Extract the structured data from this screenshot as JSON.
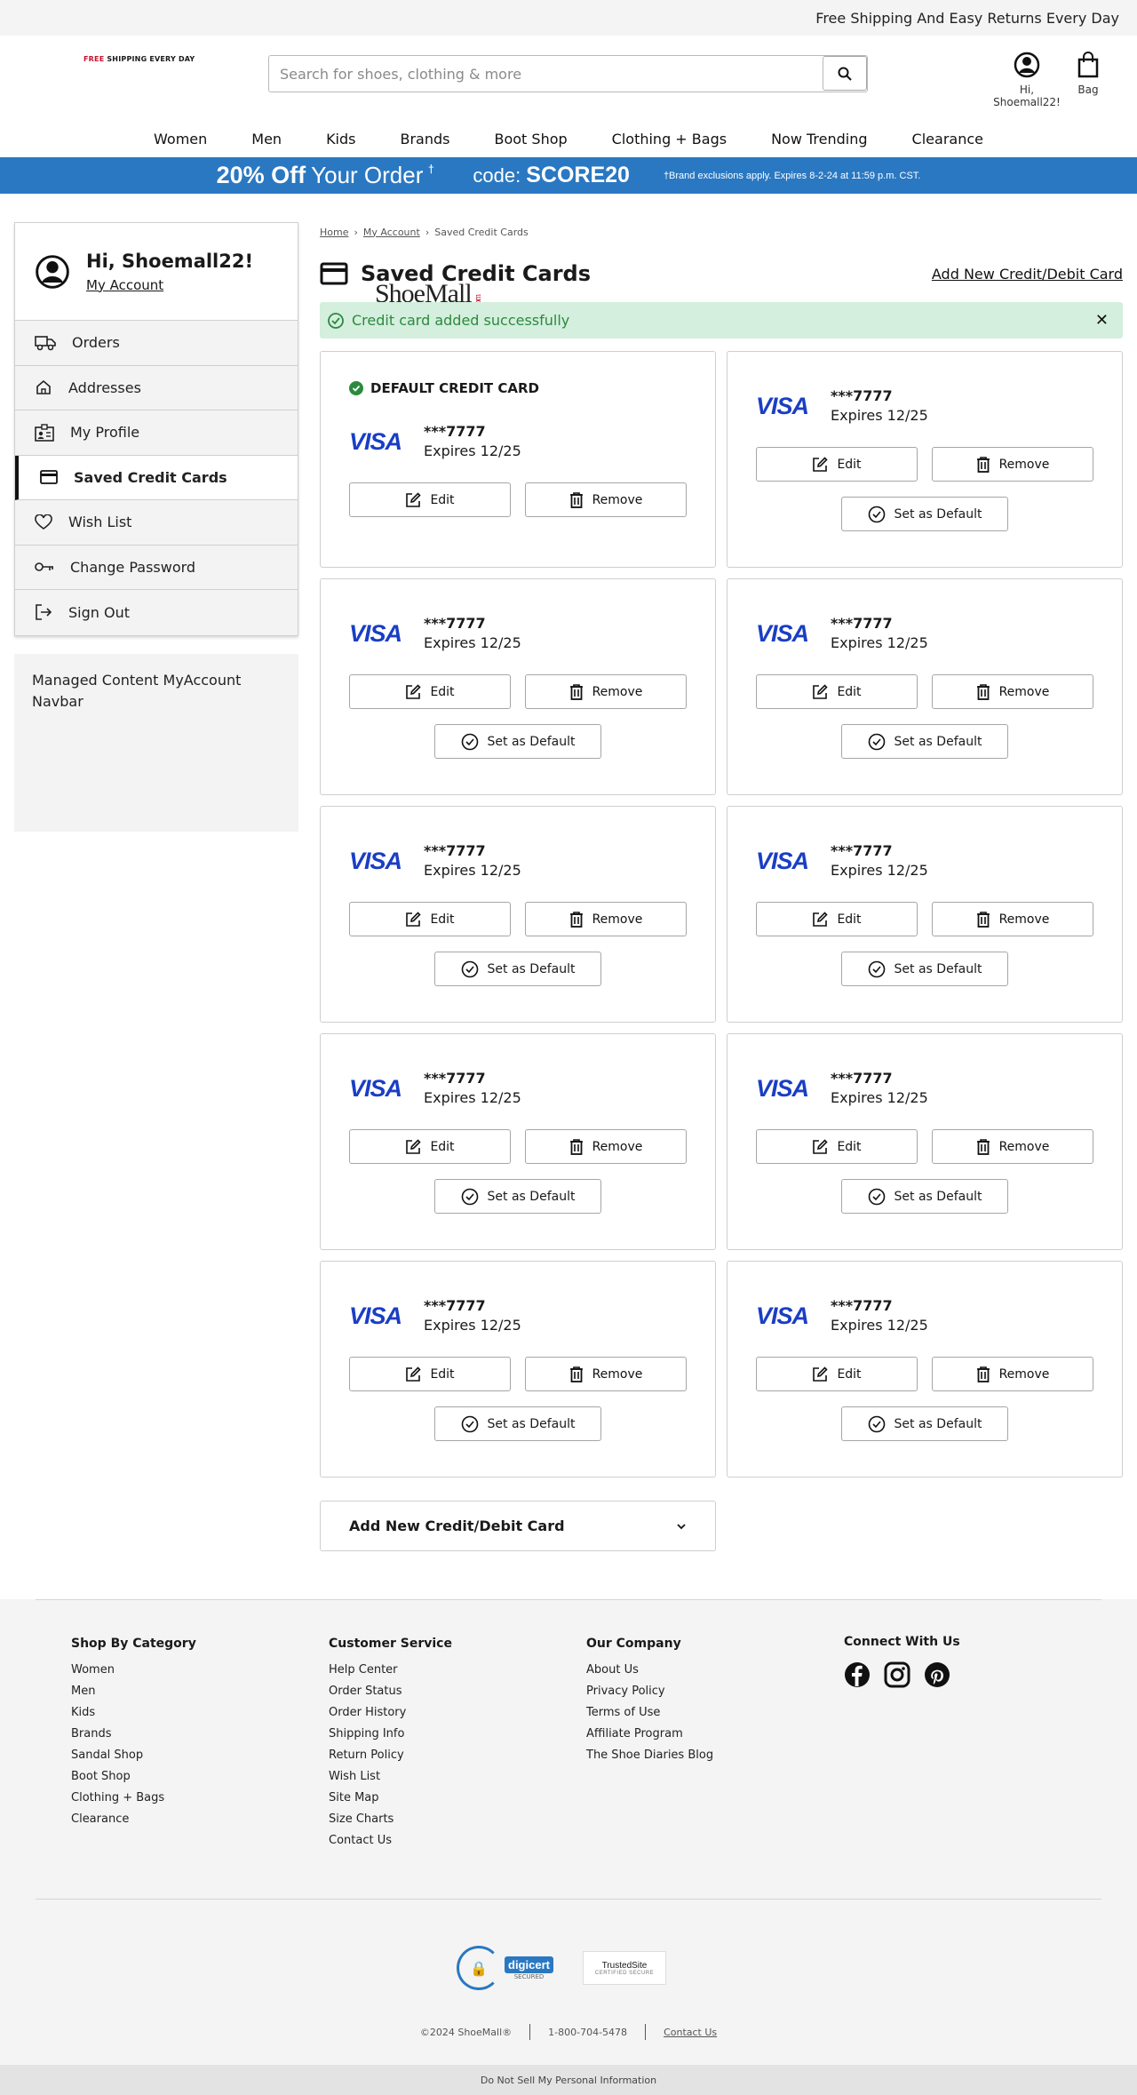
{
  "topbar": {
    "text": "Free Shipping And Easy Returns Every Day"
  },
  "header": {
    "logo_text": "ShoeMall",
    "logo_com": ".com",
    "logo_tag_red": "FREE",
    "logo_tag_rest": " SHIPPING EVERY DAY",
    "search_placeholder": "Search for shoes, clothing & more",
    "user_label": "Hi, Shoemall22!",
    "bag_label": "Bag"
  },
  "nav": [
    "Women",
    "Men",
    "Kids",
    "Brands",
    "Boot Shop",
    "Clothing + Bags",
    "Now Trending",
    "Clearance"
  ],
  "promo": {
    "big": "20% Off",
    "mid": "Your Order",
    "dagger": "†",
    "code_label": "code:",
    "code_value": "SCORE20",
    "small": "†Brand exclusions apply. Expires 8-2-24 at 11:59 p.m. CST."
  },
  "sidebar": {
    "greeting": "Hi, Shoemall22!",
    "account_link": "My Account",
    "items": [
      {
        "label": "Orders",
        "icon": "truck-icon"
      },
      {
        "label": "Addresses",
        "icon": "home-icon"
      },
      {
        "label": "My Profile",
        "icon": "profile-icon"
      },
      {
        "label": "Saved Credit Cards",
        "icon": "credit-card-icon"
      },
      {
        "label": "Wish List",
        "icon": "heart-icon"
      },
      {
        "label": "Change Password",
        "icon": "key-icon"
      },
      {
        "label": "Sign Out",
        "icon": "sign-out-icon"
      }
    ],
    "managed": "Managed Content MyAccount Navbar"
  },
  "breadcrumb": [
    "Home",
    "My Account",
    "Saved Credit Cards"
  ],
  "page": {
    "title": "Saved Credit Cards",
    "add_link": "Add New Credit/Debit Card",
    "success": "Credit card added successfully",
    "close": "✕",
    "default_label": "DEFAULT CREDIT CARD",
    "edit_label": "Edit",
    "remove_label": "Remove",
    "set_default_label": "Set as Default",
    "add_new_label": "Add New Credit/Debit Card"
  },
  "cards": [
    {
      "brand": "VISA",
      "number": "***7777",
      "expires": "Expires 12/25",
      "is_default": true
    },
    {
      "brand": "VISA",
      "number": "***7777",
      "expires": "Expires 12/25",
      "is_default": false
    },
    {
      "brand": "VISA",
      "number": "***7777",
      "expires": "Expires 12/25",
      "is_default": false
    },
    {
      "brand": "VISA",
      "number": "***7777",
      "expires": "Expires 12/25",
      "is_default": false
    },
    {
      "brand": "VISA",
      "number": "***7777",
      "expires": "Expires 12/25",
      "is_default": false
    },
    {
      "brand": "VISA",
      "number": "***7777",
      "expires": "Expires 12/25",
      "is_default": false
    },
    {
      "brand": "VISA",
      "number": "***7777",
      "expires": "Expires 12/25",
      "is_default": false
    },
    {
      "brand": "VISA",
      "number": "***7777",
      "expires": "Expires 12/25",
      "is_default": false
    },
    {
      "brand": "VISA",
      "number": "***7777",
      "expires": "Expires 12/25",
      "is_default": false
    },
    {
      "brand": "VISA",
      "number": "***7777",
      "expires": "Expires 12/25",
      "is_default": false
    }
  ],
  "footer": {
    "columns": [
      {
        "title": "Shop By Category",
        "links": [
          "Women",
          "Men",
          "Kids",
          "Brands",
          "Sandal Shop",
          "Boot Shop",
          "Clothing + Bags",
          "Clearance"
        ]
      },
      {
        "title": "Customer Service",
        "links": [
          "Help Center",
          "Order Status",
          "Order History",
          "Shipping Info",
          "Return Policy",
          "Wish List",
          "Site Map",
          "Size Charts",
          "Contact Us"
        ]
      },
      {
        "title": "Our Company",
        "links": [
          "About Us",
          "Privacy Policy",
          "Terms of Use",
          "Affiliate Program",
          "The Shoe Diaries Blog"
        ]
      }
    ],
    "connect_title": "Connect With Us",
    "seals": {
      "digicert": "digicert",
      "digicert_sub": "SECURED",
      "trusted": "TrustedSite",
      "trusted_sub": "CERTIFIED SECURE"
    },
    "copyright": "©2024 ShoeMall®",
    "phone": "1-800-704-5478",
    "contact": "Contact Us",
    "dns": "Do Not Sell My Personal Information"
  },
  "colors": {
    "promo_bg": "#2a78c2",
    "success_bg": "#d4efdd",
    "success_text": "#2b8a3e",
    "visa_blue": "#1a3ec4",
    "brand_red": "#c8102e"
  }
}
